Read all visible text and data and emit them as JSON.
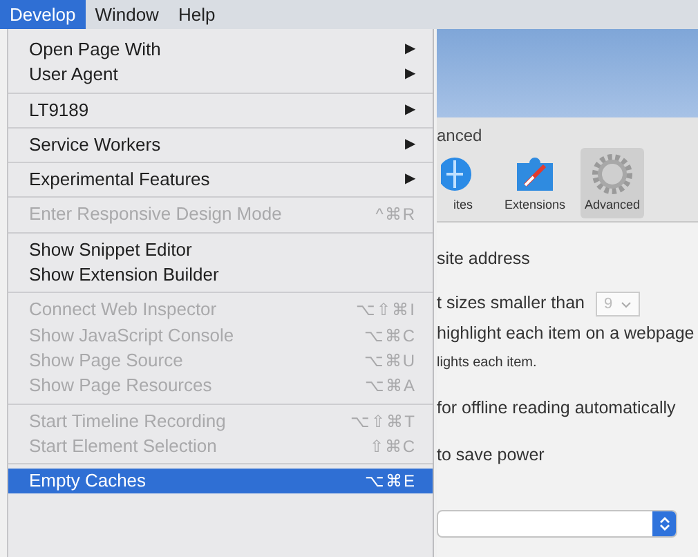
{
  "menu_bar": [
    {
      "label": "Develop",
      "selected": true
    },
    {
      "label": "Window",
      "selected": false
    },
    {
      "label": "Help",
      "selected": false
    }
  ],
  "menu": {
    "sections": [
      [
        {
          "label": "Open Page With",
          "submenu_arrow": "▶",
          "disabled": false,
          "selected": false
        },
        {
          "label": "User Agent",
          "submenu_arrow": "▶",
          "disabled": false,
          "selected": false
        }
      ],
      [
        {
          "label": "LT9189",
          "submenu_arrow": "▶",
          "disabled": false,
          "selected": false
        }
      ],
      [
        {
          "label": "Service Workers",
          "submenu_arrow": "▶",
          "disabled": false,
          "selected": false
        }
      ],
      [
        {
          "label": "Experimental Features",
          "submenu_arrow": "▶",
          "disabled": false,
          "selected": false
        }
      ],
      [
        {
          "label": "Enter Responsive Design Mode",
          "shortcut": "^⌘R",
          "disabled": true,
          "selected": false
        }
      ],
      [
        {
          "label": "Show Snippet Editor",
          "disabled": false,
          "selected": false
        },
        {
          "label": "Show Extension Builder",
          "disabled": false,
          "selected": false
        }
      ],
      [
        {
          "label": "Connect Web Inspector",
          "shortcut": "⌥⇧⌘I",
          "disabled": true,
          "selected": false
        },
        {
          "label": "Show JavaScript Console",
          "shortcut": "⌥⌘C",
          "disabled": true,
          "selected": false
        },
        {
          "label": "Show Page Source",
          "shortcut": "⌥⌘U",
          "disabled": true,
          "selected": false
        },
        {
          "label": "Show Page Resources",
          "shortcut": "⌥⌘A",
          "disabled": true,
          "selected": false
        }
      ],
      [
        {
          "label": "Start Timeline Recording",
          "shortcut": "⌥⇧⌘T",
          "disabled": true,
          "selected": false
        },
        {
          "label": "Start Element Selection",
          "shortcut": "⇧⌘C",
          "disabled": true,
          "selected": false
        }
      ],
      [
        {
          "label": "Empty Caches",
          "shortcut": "⌥⌘E",
          "disabled": false,
          "selected": true
        }
      ]
    ]
  },
  "preferences": {
    "title": "anced",
    "toolbar": [
      {
        "label": "ites",
        "kind": "websites",
        "selected": false
      },
      {
        "label": "Extensions",
        "kind": "extensions",
        "selected": false
      },
      {
        "label": "Advanced",
        "kind": "advanced",
        "selected": true
      }
    ],
    "rows": [
      {
        "kind": "text",
        "text": "site address"
      },
      {
        "kind": "select",
        "text": "t sizes smaller than",
        "value": "9"
      },
      {
        "kind": "text",
        "text": "highlight each item on a webpage"
      },
      {
        "kind": "note",
        "text": "lights each item."
      },
      {
        "kind": "text",
        "text": "for offline reading automatically"
      },
      {
        "kind": "text",
        "text": "to save power"
      },
      {
        "kind": "popup"
      }
    ]
  }
}
